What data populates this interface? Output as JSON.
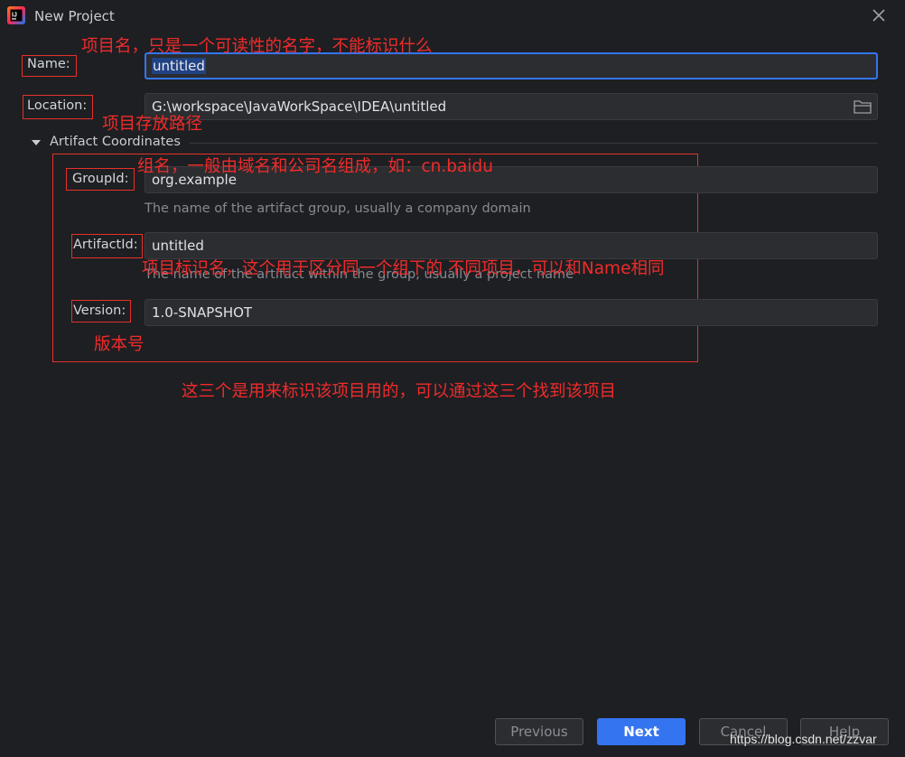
{
  "window": {
    "title": "New Project",
    "logo_text": "IJ"
  },
  "form": {
    "name": {
      "label": "Name:",
      "value": "untitled"
    },
    "location": {
      "label": "Location:",
      "value": "G:\\workspace\\JavaWorkSpace\\IDEA\\untitled"
    },
    "section_title": "Artifact Coordinates",
    "group_id": {
      "label": "GroupId:",
      "value": "org.example",
      "hint": "The name of the artifact group, usually a company domain"
    },
    "artifact_id": {
      "label": "ArtifactId:",
      "value": "untitled",
      "hint": "The name of the artifact within the group, usually a project name"
    },
    "version": {
      "label": "Version:",
      "value": "1.0-SNAPSHOT"
    }
  },
  "annotations": {
    "name_note": "项目名，只是一个可读性的名字，不能标识什么",
    "location_note": "项目存放路径",
    "group_note": "组名，一般由域名和公司名组成，如：cn.baidu",
    "artifact_note": "项目标识名，这个用于区分同一个组下的 不同项目，可以和Name相同",
    "version_note": "版本号",
    "summary_note": "这三个是用来标识该项目用的，可以通过这三个找到该项目"
  },
  "buttons": {
    "previous": "Previous",
    "next": "Next",
    "cancel": "Cancel",
    "help": "Help"
  },
  "watermark": "https://blog.csdn.net/zzvar",
  "colors": {
    "background": "#1e1f22",
    "field_bg": "#2b2d30",
    "accent": "#3574f0",
    "annotation_red": "#e5312b"
  },
  "icons": [
    "intellij-logo-icon",
    "close-icon",
    "folder-icon",
    "triangle-down-icon"
  ]
}
